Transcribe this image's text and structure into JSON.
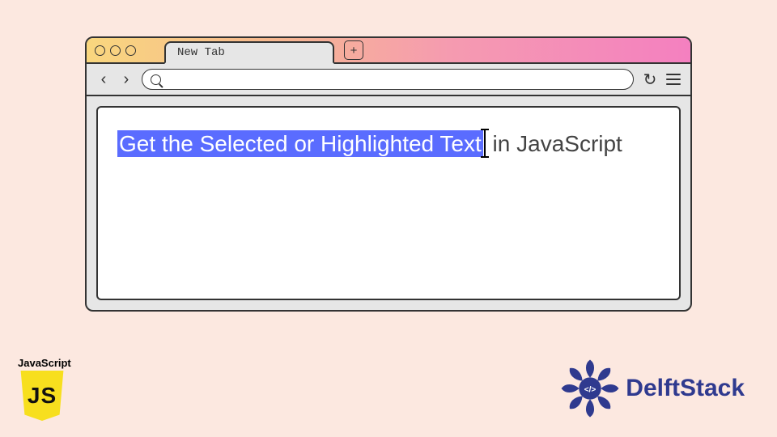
{
  "browser": {
    "tab_label": "New Tab",
    "new_tab_symbol": "+",
    "nav": {
      "back": "‹",
      "forward": "›"
    },
    "reload_symbol": "↻"
  },
  "article": {
    "highlighted_part": "Get the Selected or Highlighted Text",
    "unhighlighted_part": " in JavaScript"
  },
  "badges": {
    "js_label": "JavaScript",
    "js_short": "JS",
    "brand": "DelftStack"
  }
}
